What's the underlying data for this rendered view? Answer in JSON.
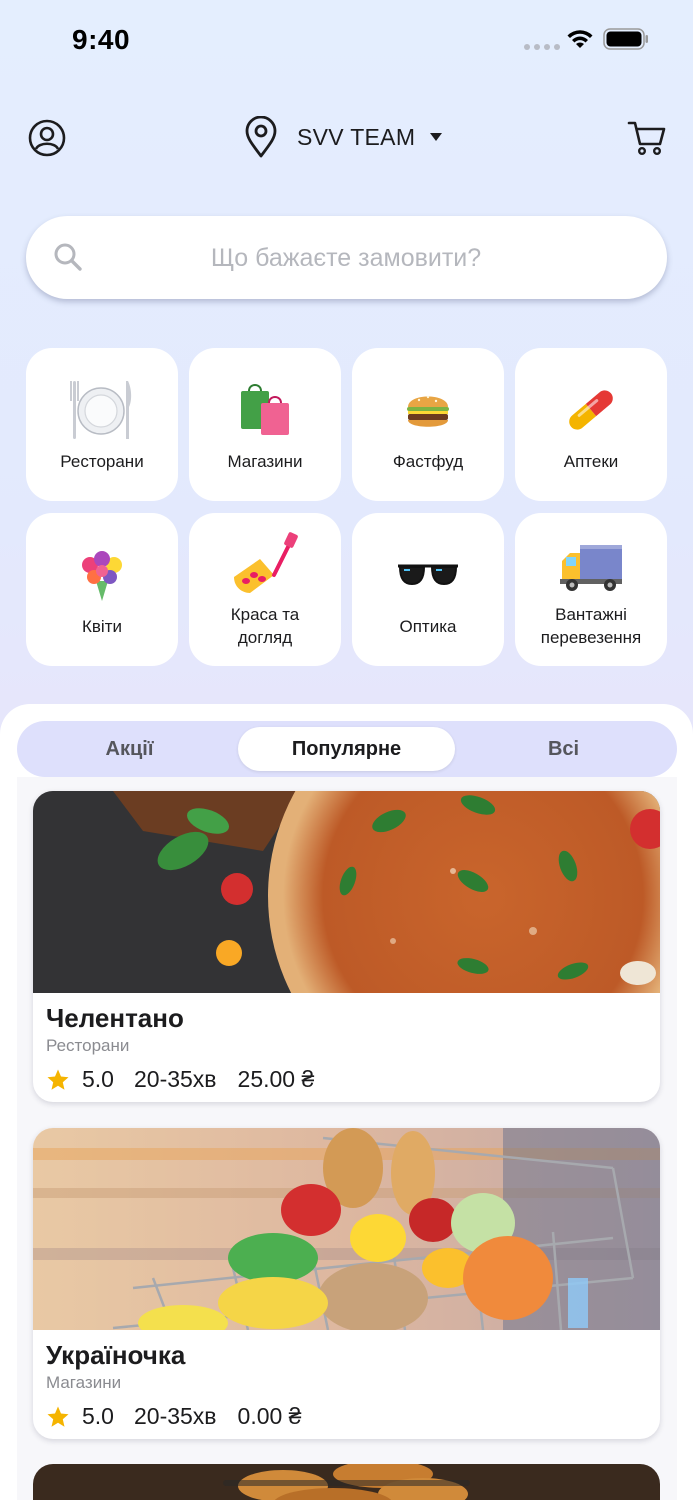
{
  "status": {
    "time": "9:40"
  },
  "header": {
    "location": "SVV TEAM"
  },
  "search": {
    "placeholder": "Що бажаєте замовити?"
  },
  "categories": [
    {
      "label": "Ресторани",
      "icon": "plate-icon"
    },
    {
      "label": "Магазини",
      "icon": "shopping-bags-icon"
    },
    {
      "label": "Фастфуд",
      "icon": "burger-icon"
    },
    {
      "label": "Аптеки",
      "icon": "pill-icon"
    },
    {
      "label": "Квіти",
      "icon": "bouquet-icon"
    },
    {
      "label": "Краса та догляд",
      "icon": "nail-polish-icon"
    },
    {
      "label": "Оптика",
      "icon": "sunglasses-icon"
    },
    {
      "label": "Вантажні перевезення",
      "icon": "truck-icon"
    }
  ],
  "tabs": [
    {
      "label": "Акції",
      "active": false
    },
    {
      "label": "Популярне",
      "active": true
    },
    {
      "label": "Всі",
      "active": false
    }
  ],
  "venues": [
    {
      "name": "Челентано",
      "category": "Ресторани",
      "rating": "5.0",
      "time": "20-35хв",
      "price": "25.00 ₴",
      "image": "pizza-image"
    },
    {
      "name": "Україночка",
      "category": "Магазини",
      "rating": "5.0",
      "time": "20-35хв",
      "price": "0.00 ₴",
      "image": "grocery-cart-image"
    }
  ],
  "colors": {
    "accent": "#dee0fc",
    "star": "#f5b400",
    "background": "#e4eefe"
  }
}
